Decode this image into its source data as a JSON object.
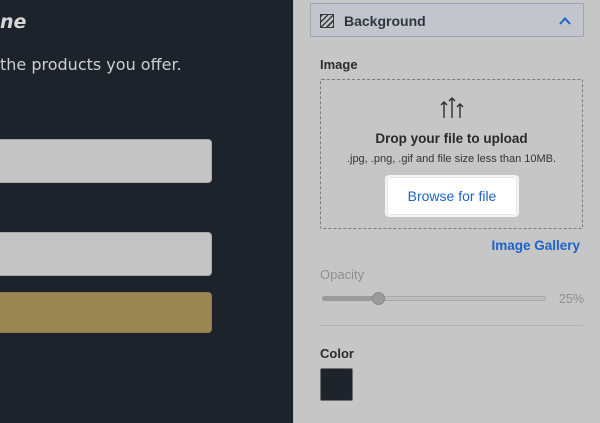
{
  "preview": {
    "title": "ne",
    "subtitle": "the products you offer."
  },
  "panel": {
    "section_header": {
      "title": "Background",
      "icon": "pattern-icon",
      "toggle_icon": "chevron-up-icon"
    },
    "image": {
      "label": "Image",
      "upload_icon": "upload-arrows-icon",
      "drop_title": "Drop your file to upload",
      "drop_hint": ".jpg, .png, .gif and file size less than 10MB.",
      "browse_label": "Browse for file",
      "gallery_link": "Image Gallery"
    },
    "opacity": {
      "label": "Opacity",
      "value_text": "25%",
      "value": 0.25
    },
    "color": {
      "label": "Color",
      "value": "#1f242c"
    },
    "colors": {
      "accent": "#1e63c6",
      "panel_bg": "#c6c6c6",
      "preview_bg": "#1d232b",
      "preview_button": "#9a8653"
    }
  }
}
